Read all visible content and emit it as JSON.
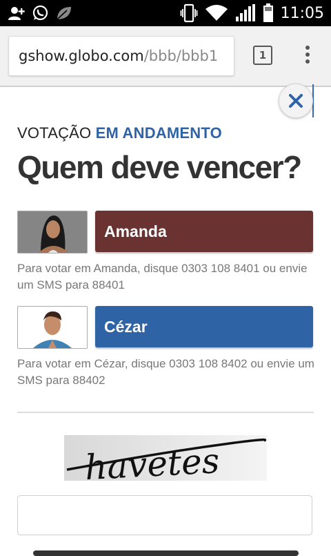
{
  "status_bar": {
    "time": "11:05",
    "icons": [
      "add-contact-icon",
      "whatsapp-icon",
      "leaf-icon",
      "vibrate-icon",
      "wifi-icon",
      "signal-icon",
      "battery-icon"
    ]
  },
  "browser": {
    "url_host": "gshow.globo.com",
    "url_path": "/bbb/bbb1",
    "tab_count": "1"
  },
  "page": {
    "voting_status_prefix": "VOTAÇÃO",
    "voting_status_accent": "EM ANDAMENTO",
    "title": "Quem deve vencer?",
    "candidates": [
      {
        "name": "Amanda",
        "instruction": "Para votar em Amanda, disque 0303 108 8401 ou envie um SMS para 88401",
        "color": "#6b3232"
      },
      {
        "name": "Cézar",
        "instruction": "Para votar em Cézar, disque 0303 108 8402 ou envie um SMS para 88402",
        "color": "#2e63a5"
      }
    ],
    "captcha_text": "havetes",
    "captcha_input_value": "",
    "accent_color": "#2f63a8"
  }
}
